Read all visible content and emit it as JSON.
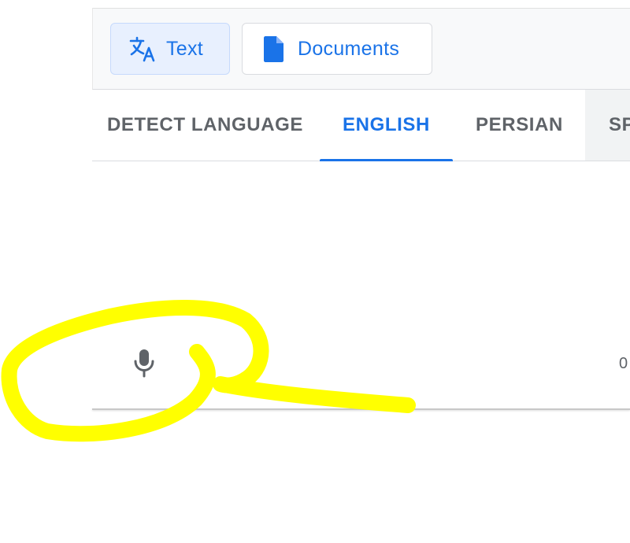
{
  "mode_bar": {
    "text_label": "Text",
    "documents_label": "Documents"
  },
  "language_tabs": [
    {
      "label": "DETECT LANGUAGE",
      "selected": false
    },
    {
      "label": "ENGLISH",
      "selected": true
    },
    {
      "label": "PERSIAN",
      "selected": false
    },
    {
      "label": "SP",
      "selected": false
    }
  ],
  "input": {
    "char_count": "0"
  },
  "icons": {
    "text_mode": "translate-icon",
    "documents_mode": "document-icon",
    "voice_input": "microphone-icon"
  },
  "colors": {
    "accent": "#1a73e8",
    "tab_text": "#5f6368",
    "annotation": "#ffff00"
  }
}
